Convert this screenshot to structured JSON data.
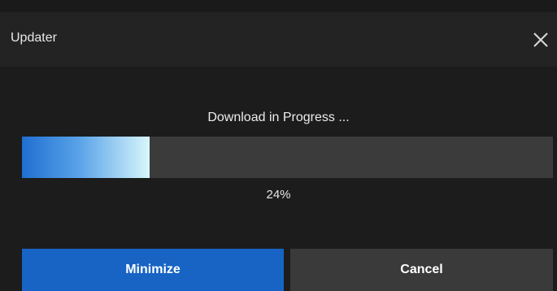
{
  "window": {
    "title": "Updater"
  },
  "icons": {
    "close": "close-icon"
  },
  "progress": {
    "status_label": "Download in Progress ...",
    "value": 0.24,
    "percent_label": "24%"
  },
  "buttons": {
    "minimize_label": "Minimize",
    "cancel_label": "Cancel"
  },
  "colors": {
    "primary_button": "#1764c4",
    "secondary_button": "#3a3a3a",
    "progress_start": "#1f6fd1",
    "progress_end": "#d8f6fb",
    "track": "#3b3b3b",
    "background": "#1c1c1c"
  }
}
